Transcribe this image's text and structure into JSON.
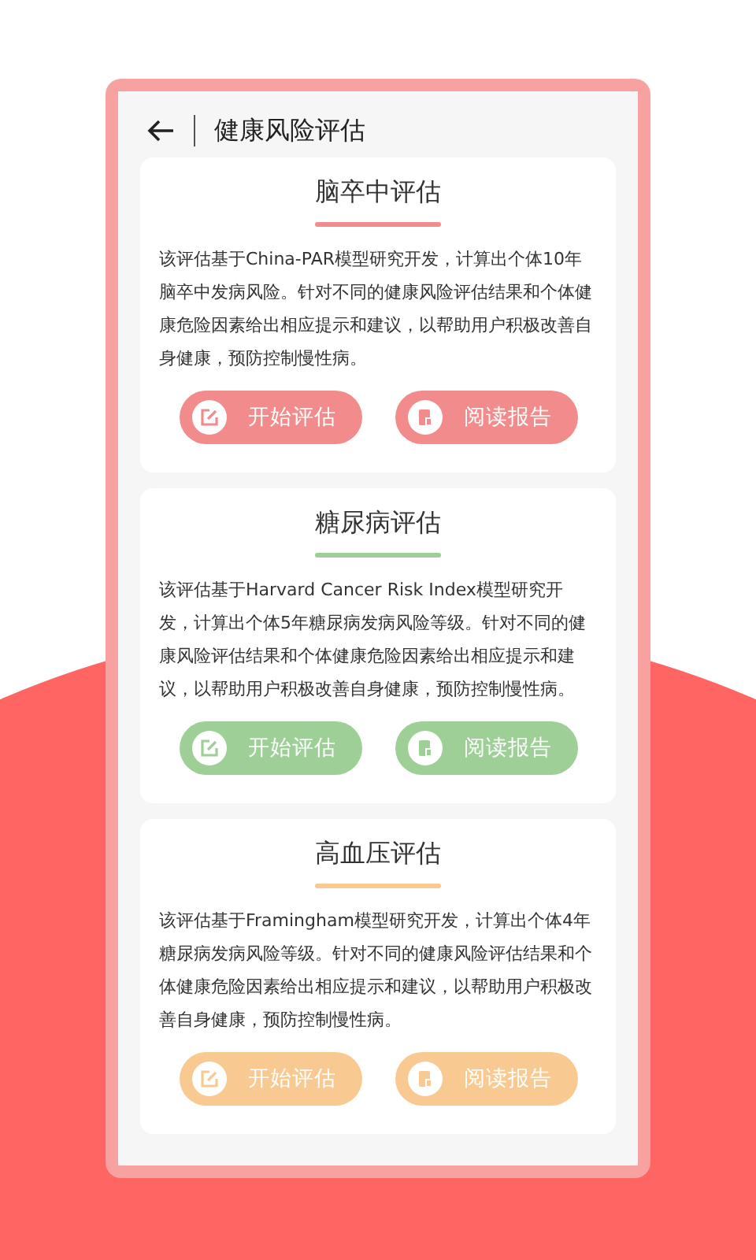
{
  "header": {
    "title": "健康风险评估"
  },
  "cards": [
    {
      "title": "脑卒中评估",
      "color": "#f28c8c",
      "description": "该评估基于China-PAR模型研究开发，计算出个体10年脑卒中发病风险。针对不同的健康风险评估结果和个体健康危险因素给出相应提示和建议，以帮助用户积极改善自身健康，预防控制慢性病。",
      "buttons": [
        {
          "kind": "start",
          "label": "开始评估"
        },
        {
          "kind": "report",
          "label": "阅读报告"
        }
      ]
    },
    {
      "title": "糖尿病评估",
      "color": "#9dcf97",
      "description": "该评估基于Harvard Cancer Risk Index模型研究开发，计算出个体5年糖尿病发病风险等级。针对不同的健康风险评估结果和个体健康危险因素给出相应提示和建议，以帮助用户积极改善自身健康，预防控制慢性病。",
      "buttons": [
        {
          "kind": "start",
          "label": "开始评估"
        },
        {
          "kind": "report",
          "label": "阅读报告"
        }
      ]
    },
    {
      "title": "高血压评估",
      "color": "#f8c990",
      "description": "该评估基于Framingham模型研究开发，计算出个体4年糖尿病发病风险等级。针对不同的健康风险评估结果和个体健康危险因素给出相应提示和建议，以帮助用户积极改善自身健康，预防控制慢性病。",
      "buttons": [
        {
          "kind": "start",
          "label": "开始评估"
        },
        {
          "kind": "report",
          "label": "阅读报告"
        }
      ]
    }
  ]
}
